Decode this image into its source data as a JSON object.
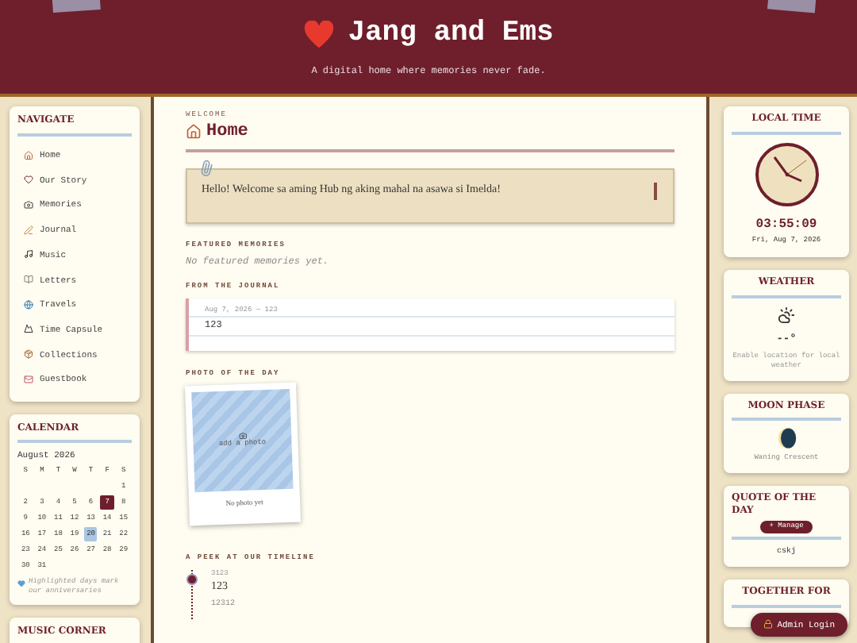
{
  "header": {
    "title": "Jang and Ems",
    "subtitle": "A digital home where memories never fade."
  },
  "navigate": {
    "title": "NAVIGATE",
    "items": [
      {
        "label": "Home"
      },
      {
        "label": "Our Story"
      },
      {
        "label": "Memories"
      },
      {
        "label": "Journal"
      },
      {
        "label": "Music"
      },
      {
        "label": "Letters"
      },
      {
        "label": "Travels"
      },
      {
        "label": "Time Capsule"
      },
      {
        "label": "Collections"
      },
      {
        "label": "Guestbook"
      }
    ]
  },
  "calendar": {
    "title": "CALENDAR",
    "month": "August 2026",
    "weekdays": [
      "S",
      "M",
      "T",
      "W",
      "T",
      "F",
      "S"
    ],
    "weeks": [
      [
        {
          "day": "1",
          "selected": false,
          "highlighted": false
        }
      ],
      [
        {
          "day": "2",
          "selected": false,
          "highlighted": false
        },
        {
          "day": "3",
          "selected": false,
          "highlighted": false
        },
        {
          "day": "4",
          "selected": false,
          "highlighted": false
        },
        {
          "day": "5",
          "selected": false,
          "highlighted": false
        },
        {
          "day": "6",
          "selected": false,
          "highlighted": false
        },
        {
          "day": "7",
          "selected": true,
          "highlighted": false
        },
        {
          "day": "8",
          "selected": false,
          "highlighted": false
        }
      ],
      [
        {
          "day": "9",
          "selected": false,
          "highlighted": false
        },
        {
          "day": "10",
          "selected": false,
          "highlighted": false
        },
        {
          "day": "11",
          "selected": false,
          "highlighted": false
        },
        {
          "day": "12",
          "selected": false,
          "highlighted": false
        },
        {
          "day": "13",
          "selected": false,
          "highlighted": false
        },
        {
          "day": "14",
          "selected": false,
          "highlighted": false
        },
        {
          "day": "15",
          "selected": false,
          "highlighted": false
        }
      ],
      [
        {
          "day": "16",
          "selected": false,
          "highlighted": false
        },
        {
          "day": "17",
          "selected": false,
          "highlighted": false
        },
        {
          "day": "18",
          "selected": false,
          "highlighted": false
        },
        {
          "day": "19",
          "selected": false,
          "highlighted": false
        },
        {
          "day": "20",
          "selected": false,
          "highlighted": true
        },
        {
          "day": "21",
          "selected": false,
          "highlighted": false
        },
        {
          "day": "22",
          "selected": false,
          "highlighted": false
        }
      ],
      [
        {
          "day": "23",
          "selected": false,
          "highlighted": false
        },
        {
          "day": "24",
          "selected": false,
          "highlighted": false
        },
        {
          "day": "25",
          "selected": false,
          "highlighted": false
        },
        {
          "day": "26",
          "selected": false,
          "highlighted": false
        },
        {
          "day": "27",
          "selected": false,
          "highlighted": false
        },
        {
          "day": "28",
          "selected": false,
          "highlighted": false
        },
        {
          "day": "29",
          "selected": false,
          "highlighted": false
        }
      ],
      [
        {
          "day": "30",
          "selected": false,
          "highlighted": false
        },
        {
          "day": "31",
          "selected": false,
          "highlighted": false
        }
      ]
    ],
    "note": "Highlighted days mark our anniversaries"
  },
  "music": {
    "title": "MUSIC CORNER"
  },
  "main": {
    "eyebrow": "WELCOME",
    "title": "Home",
    "welcome": "Hello! Welcome sa aming Hub ng aking mahal na asawa si Imelda!",
    "featured": {
      "heading": "FEATURED MEMORIES",
      "empty": "No featured memories yet."
    },
    "journal": {
      "heading": "FROM THE JOURNAL",
      "meta": "Aug 7, 2026 — 123",
      "body": "123"
    },
    "photo": {
      "heading": "PHOTO OF THE DAY",
      "add": "add a photo",
      "caption": "No photo yet"
    },
    "timeline": {
      "heading": "A PEEK AT OUR TIMELINE",
      "date": "3123",
      "title": "123",
      "body": "12312"
    }
  },
  "right": {
    "time": {
      "title": "LOCAL TIME",
      "clock": "03:55:09",
      "date": "Fri, Aug 7, 2026"
    },
    "weather": {
      "title": "WEATHER",
      "temp": "--°",
      "note": "Enable location for local weather"
    },
    "moon": {
      "title": "MOON PHASE",
      "phase": "Waning Crescent"
    },
    "quote": {
      "title": "QUOTE OF THE DAY",
      "manage": "+ Manage",
      "text": "cskj"
    },
    "together": {
      "title": "TOGETHER FOR"
    }
  },
  "admin": {
    "label": "Admin Login"
  }
}
